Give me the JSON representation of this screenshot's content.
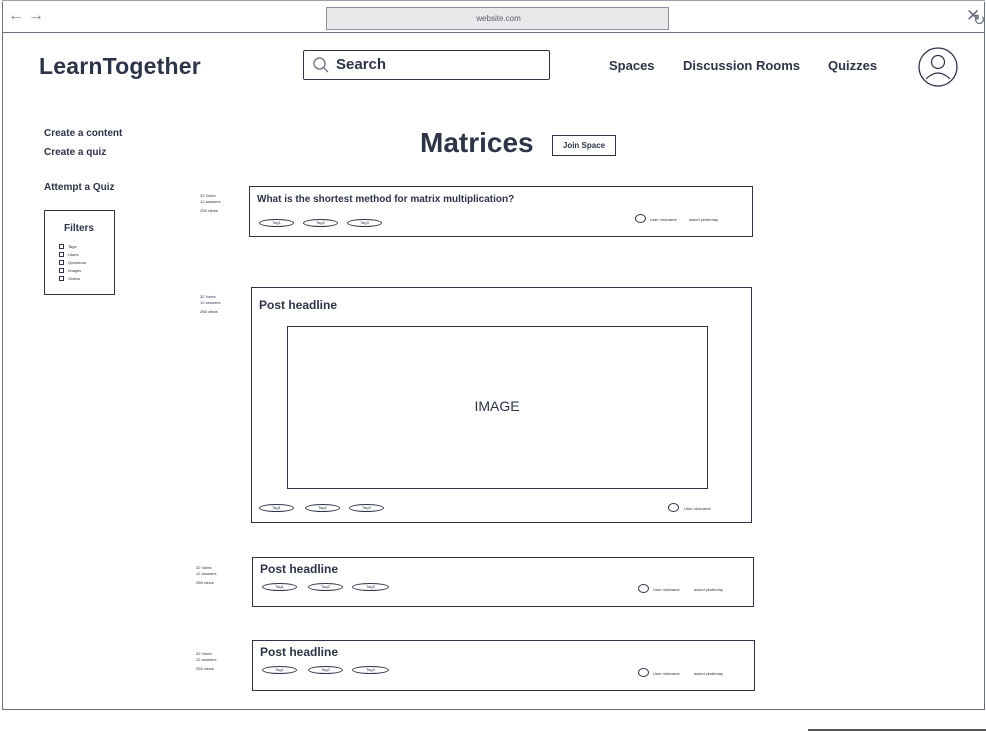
{
  "browser": {
    "url": "website.com",
    "back_icon": "arrow-left-icon",
    "forward_icon": "arrow-right-icon",
    "reload_icon": "reload-icon",
    "close_icon": "close-icon"
  },
  "header": {
    "logo": "LearnTogether",
    "search_label": "Search",
    "nav": [
      "Spaces",
      "Discussion Rooms",
      "Quizzes"
    ]
  },
  "sidebar": {
    "links": [
      "Create a content",
      "Create a quiz",
      "Attempt a Quiz"
    ],
    "filters": {
      "title": "Filters",
      "items": [
        "Tags",
        "Users",
        "Questions",
        "Images",
        "Videos"
      ]
    }
  },
  "page": {
    "title": "Matrices",
    "join_label": "Join Space"
  },
  "posts": [
    {
      "title": "What is the shortest method for matrix multiplication?",
      "stats": [
        "32 Votes",
        "12 answers",
        "256 views"
      ],
      "tags": [
        "Tag1",
        "Tag2",
        "Tag3"
      ],
      "user": "User nickname",
      "asked": "asked yesterday"
    },
    {
      "title": "Post headline",
      "stats": [
        "32 Votes",
        "12 answers",
        "256 views"
      ],
      "image_label": "IMAGE",
      "tags": [
        "Tag1",
        "Tag2",
        "Tag3"
      ],
      "user": "User nickname"
    },
    {
      "title": "Post headline",
      "stats": [
        "32 Votes",
        "12 answers",
        "256 views"
      ],
      "tags": [
        "Tag1",
        "Tag2",
        "Tag3"
      ],
      "user": "User nickname",
      "asked": "asked yesterday"
    },
    {
      "title": "Post headline",
      "stats": [
        "32 Votes",
        "12 answers",
        "256 views"
      ],
      "tags": [
        "Tag1",
        "Tag2",
        "Tag3"
      ],
      "user": "User nickname",
      "asked": "asked yesterday"
    }
  ]
}
